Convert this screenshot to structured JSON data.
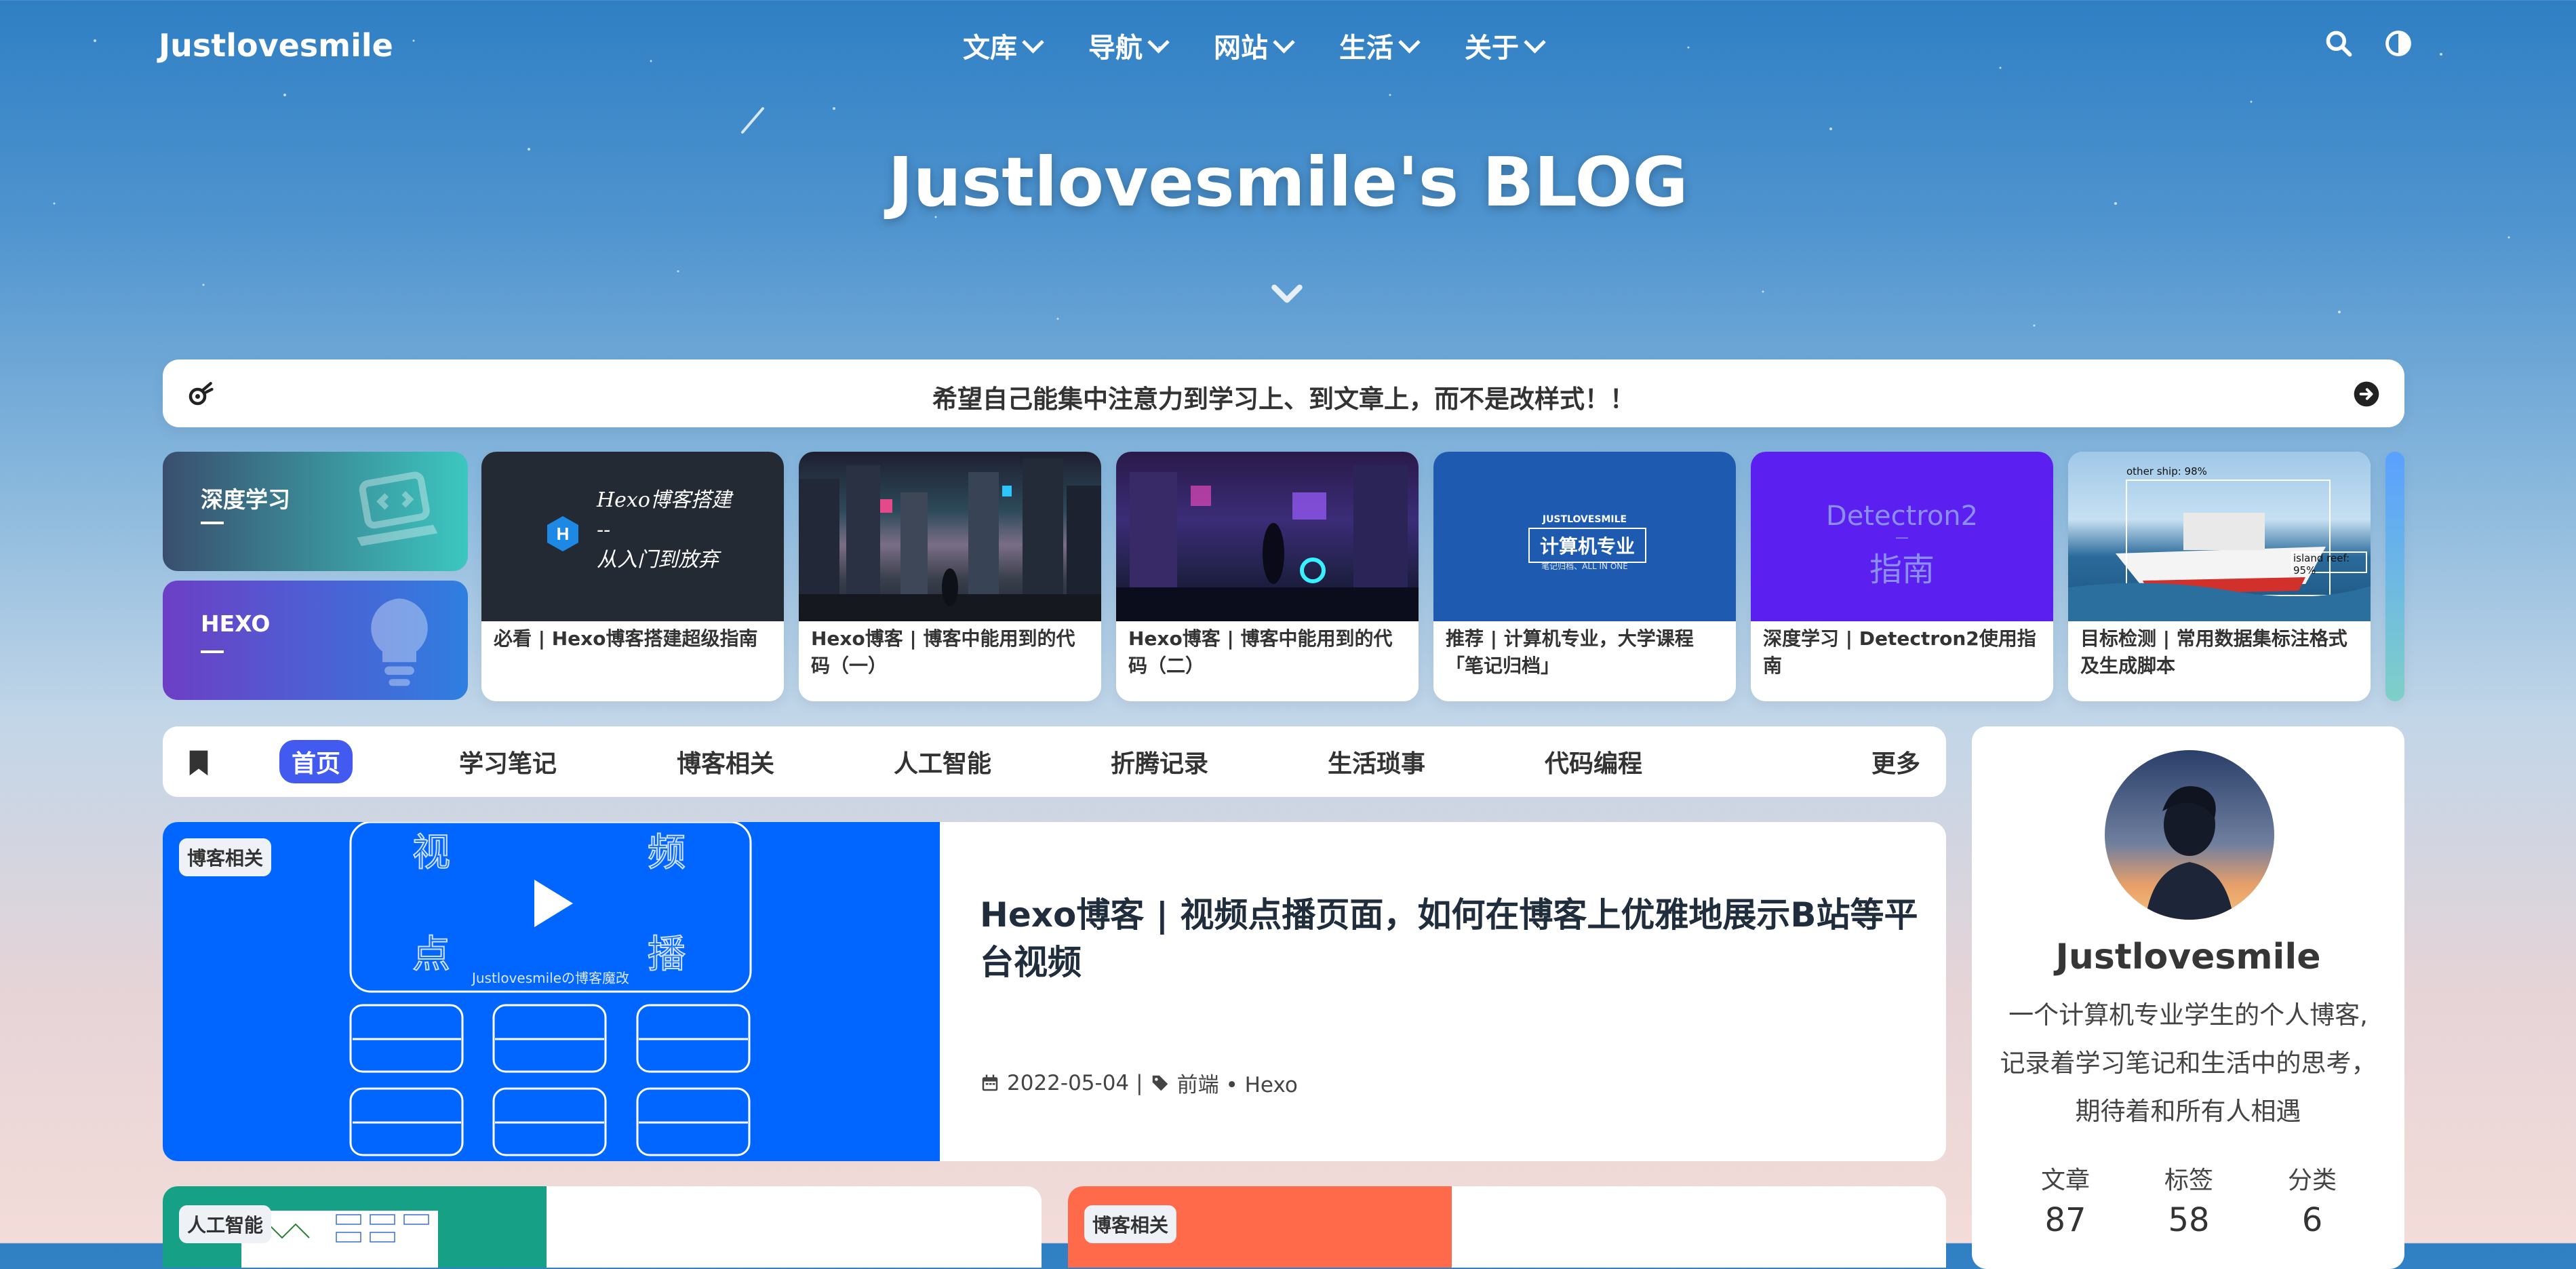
{
  "site": {
    "brand": "Justlovesmile",
    "hero_title": "Justlovesmile's BLOG"
  },
  "nav": {
    "menu": [
      "文库",
      "导航",
      "网站",
      "生活",
      "关于"
    ],
    "icons": [
      "search-icon",
      "theme-toggle-icon"
    ]
  },
  "notice": {
    "text": "希望自己能集中注意力到学习上、到文章上，而不是改样式！！"
  },
  "categories": [
    {
      "label": "深度学习",
      "icon": "laptop-code-icon",
      "gradient": [
        "#3a4e6e",
        "#3cc7c0"
      ]
    },
    {
      "label": "HEXO",
      "icon": "lightbulb-icon",
      "gradient": [
        "#6c3fc6",
        "#2f7fe0"
      ]
    }
  ],
  "feature_cards": [
    {
      "title": "必看 | Hexo博客搭建超级指南",
      "thumb_text": [
        "Hexo博客搭建",
        "--",
        "从入门到放弃"
      ]
    },
    {
      "title": "Hexo博客 | 博客中能用到的代码（一）"
    },
    {
      "title": "Hexo博客 | 博客中能用到的代码（二）"
    },
    {
      "title": "推荐 | 计算机专业，大学课程「笔记归档」",
      "thumb_text": [
        "JUSTLOVESMILE",
        "计算机专业",
        "笔记归档、ALL IN ONE"
      ]
    },
    {
      "title": "深度学习 | Detectron2使用指南",
      "thumb_text": [
        "Detectron2",
        "—",
        "指南"
      ]
    },
    {
      "title": "目标检测 | 常用数据集标注格式及生成脚本",
      "thumb_text": [
        "other ship: 98%",
        "island reef: 95%"
      ]
    }
  ],
  "tabs": [
    "首页",
    "学习笔记",
    "博客相关",
    "人工智能",
    "折腾记录",
    "生活琐事",
    "代码编程",
    "更多"
  ],
  "main_post": {
    "tag": "博客相关",
    "title": "Hexo博客 | 视频点播页面，如何在博客上优雅地展示B站等平台视频",
    "date": "2022-05-04",
    "categories": "前端 • Hexo",
    "thumb_chars": [
      "视",
      "频",
      "点",
      "播"
    ],
    "thumb_caption": "Justlovesmileの博客魔改"
  },
  "profile": {
    "name": "Justlovesmile",
    "desc": [
      "一个计算机专业学生的个人博客,",
      "记录着学习笔记和生活中的思考，",
      "期待着和所有人相遇"
    ],
    "stats": [
      {
        "label": "文章",
        "value": "87"
      },
      {
        "label": "标签",
        "value": "58"
      },
      {
        "label": "分类",
        "value": "6"
      }
    ]
  },
  "bottom_cards": [
    {
      "tag": "人工智能",
      "color": "#16a085"
    },
    {
      "tag": "博客相关",
      "color": "#ff6b4a"
    }
  ],
  "colors": {
    "accent": "#425aef",
    "video_blue": "#0066ff"
  }
}
